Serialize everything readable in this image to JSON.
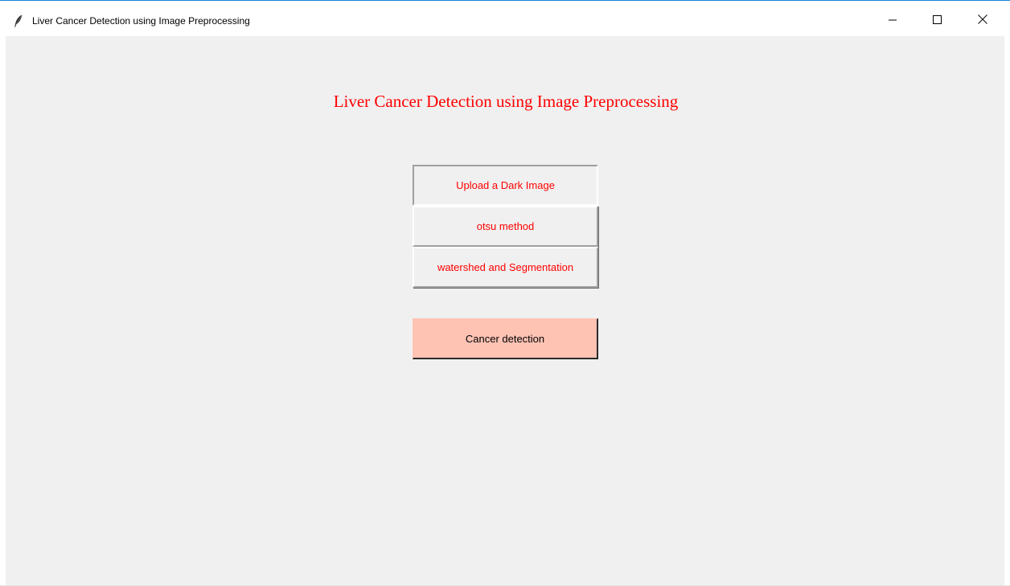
{
  "window": {
    "title": "Liver Cancer Detection using Image Preprocessing",
    "app_icon": "feather-icon",
    "controls": {
      "minimize_icon": "minimize-icon",
      "maximize_icon": "maximize-icon",
      "close_icon": "close-icon"
    }
  },
  "main": {
    "heading": "Liver Cancer Detection using Image Preprocessing",
    "buttons": {
      "upload_label": "Upload a Dark Image",
      "otsu_label": "otsu method",
      "watershed_label": "watershed and Segmentation",
      "cancer_label": "Cancer detection"
    }
  },
  "colors": {
    "heading_text": "#ff0000",
    "button_text": "#ff0000",
    "cancer_button_bg": "#ffc3b4",
    "background": "#f0f0f0",
    "window_accent": "#1883d7"
  }
}
